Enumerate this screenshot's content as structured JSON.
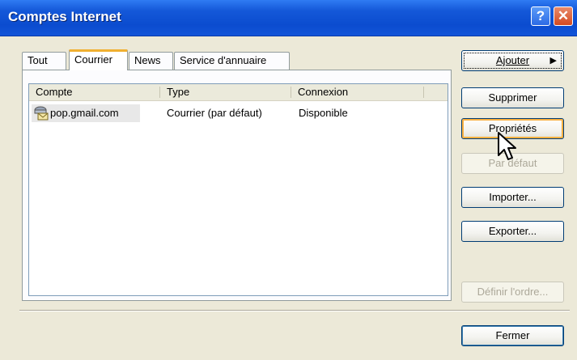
{
  "window": {
    "title": "Comptes Internet"
  },
  "tabs": [
    {
      "label": "Tout"
    },
    {
      "label": "Courrier"
    },
    {
      "label": "News"
    },
    {
      "label": "Service d'annuaire"
    }
  ],
  "list": {
    "columns": [
      "Compte",
      "Type",
      "Connexion"
    ],
    "rows": [
      {
        "account": "pop.gmail.com",
        "type": "Courrier (par défaut)",
        "connection": "Disponible"
      }
    ]
  },
  "buttons": {
    "add": "Ajouter",
    "remove": "Supprimer",
    "properties": "Propriétés",
    "set_default": "Par défaut",
    "import": "Importer...",
    "export": "Exporter...",
    "set_order": "Définir l'ordre...",
    "close": "Fermer"
  },
  "icons": {
    "help": "help-icon",
    "close": "close-icon",
    "account": "mail-account-icon",
    "submenu": "triangle-right-icon"
  }
}
